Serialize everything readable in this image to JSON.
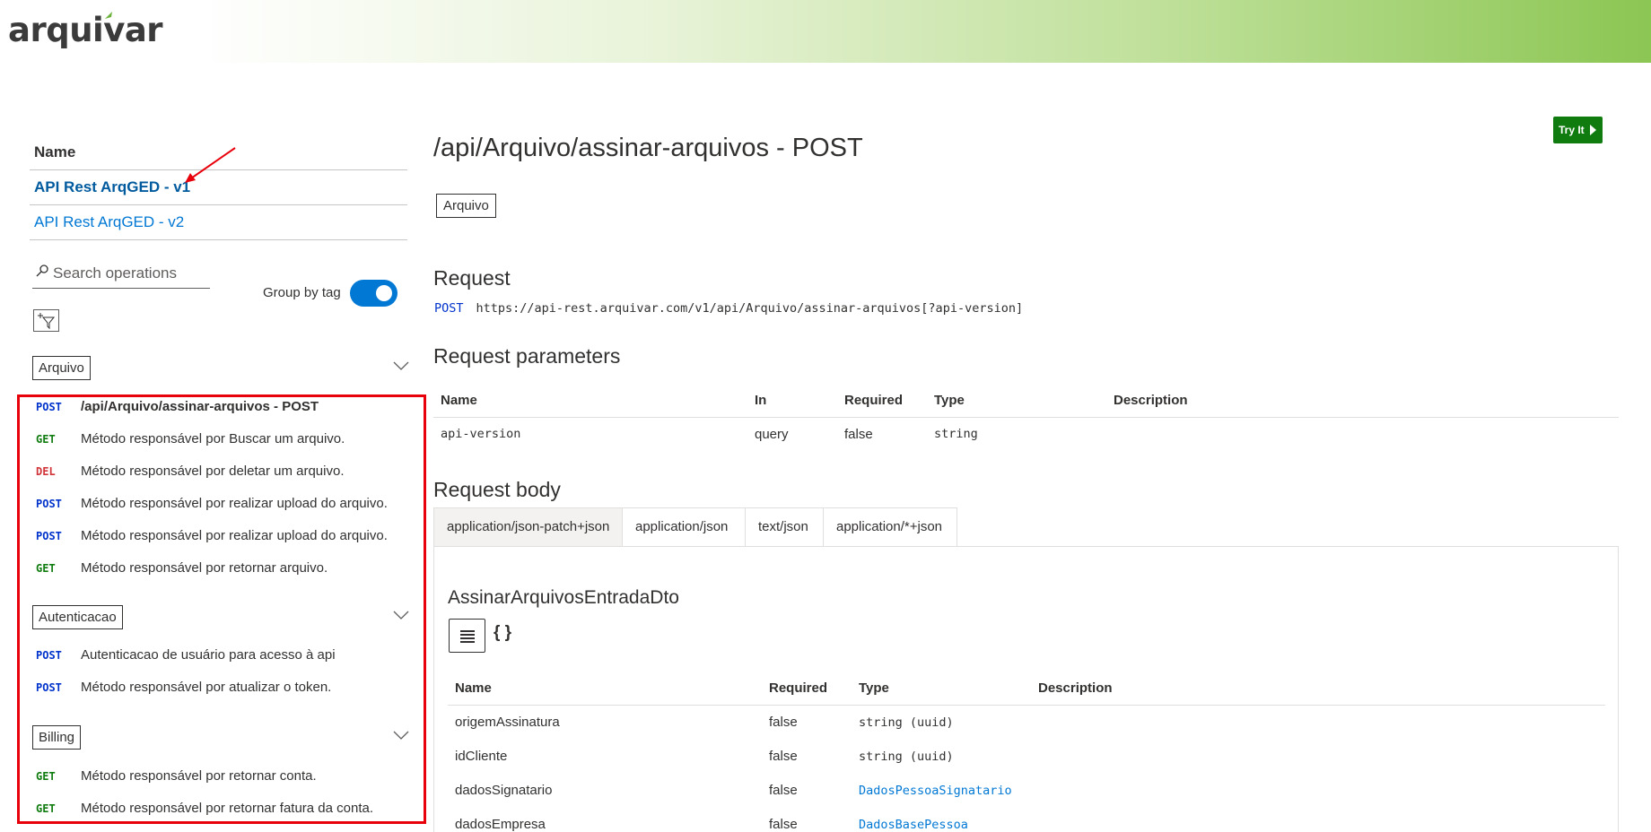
{
  "brand": {
    "logo_text": "arquivar"
  },
  "left": {
    "name_header": "Name",
    "apis": [
      "API Rest ArqGED - v1",
      "API Rest ArqGED - v2"
    ],
    "search_placeholder": "Search operations",
    "group_by_label": "Group by tag",
    "group_by_enabled": true,
    "groups": [
      {
        "tag": "Arquivo",
        "operations": [
          {
            "method": "POST",
            "label": "/api/Arquivo/assinar-arquivos - POST"
          },
          {
            "method": "GET",
            "label": "Método responsável por Buscar um arquivo."
          },
          {
            "method": "DEL",
            "label": "Método responsável por deletar um arquivo."
          },
          {
            "method": "POST",
            "label": "Método responsável por realizar upload do arquivo."
          },
          {
            "method": "POST",
            "label": "Método responsável por realizar upload do arquivo."
          },
          {
            "method": "GET",
            "label": "Método responsável por retornar arquivo."
          }
        ]
      },
      {
        "tag": "Autenticacao",
        "operations": [
          {
            "method": "POST",
            "label": "Autenticacao de usuário para acesso à api"
          },
          {
            "method": "POST",
            "label": "Método responsável por atualizar o token."
          }
        ]
      },
      {
        "tag": "Billing",
        "operations": [
          {
            "method": "GET",
            "label": "Método responsável por retornar conta."
          },
          {
            "method": "GET",
            "label": "Método responsável por retornar fatura da conta."
          }
        ]
      }
    ]
  },
  "main": {
    "title": "/api/Arquivo/assinar-arquivos - POST",
    "tag": "Arquivo",
    "try_it": "Try It",
    "request_heading": "Request",
    "request_method": "POST",
    "request_url": "https://api-rest.arquivar.com/v1/api/Arquivo/assinar-arquivos[?api-version]",
    "params_heading": "Request parameters",
    "params_columns": [
      "Name",
      "In",
      "Required",
      "Type",
      "Description"
    ],
    "params_rows": [
      [
        "api-version",
        "query",
        "false",
        "string",
        ""
      ]
    ],
    "body_heading": "Request body",
    "body_tabs": [
      "application/json-patch+json",
      "application/json",
      "text/json",
      "application/*+json"
    ],
    "dto_name": "AssinarArquivosEntradaDto",
    "braces": "{ }",
    "body_columns": [
      "Name",
      "Required",
      "Type",
      "Description"
    ],
    "body_rows": [
      [
        "origemAssinatura",
        "false",
        "string (uuid)",
        ""
      ],
      [
        "idCliente",
        "false",
        "string (uuid)",
        ""
      ],
      [
        "dadosSignatario",
        "false",
        "DadosPessoaSignatario",
        ""
      ],
      [
        "dadosEmpresa",
        "false",
        "DadosBasePessoa",
        ""
      ]
    ]
  },
  "colors": {
    "post": "#0033cc",
    "get": "#107c10",
    "del": "#d13438",
    "accent": "#0078d4",
    "highlight": "#e8000b",
    "try_button": "#107c10"
  }
}
